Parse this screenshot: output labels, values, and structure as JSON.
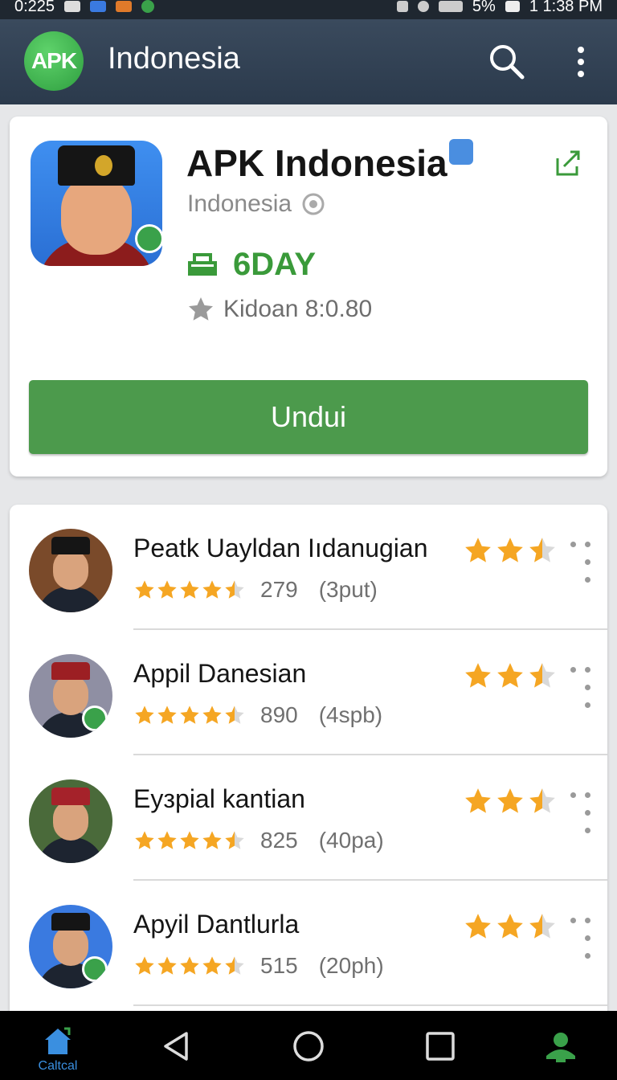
{
  "status_bar": {
    "time_left": "0:225",
    "battery": "5%",
    "time_right": "1 1:38 PM"
  },
  "app_bar": {
    "logo_text": "APK",
    "title": "Indonesia"
  },
  "hero": {
    "app_name": "APK Indonesia",
    "subtitle": "Indonesia",
    "promo": "6DAY",
    "rating_text": "Kidoan 8:0.80",
    "download_label": "Undui"
  },
  "items": [
    {
      "title": "Peatk Uayldan Iıdanugian",
      "count": "279",
      "size": "(3put)",
      "stars": 4.5,
      "mini_stars": 2.5,
      "cap": "#151515",
      "bg": "#7a4a2a",
      "check": false
    },
    {
      "title": "Appil Danesian",
      "count": "890",
      "size": "(4spb)",
      "stars": 4.5,
      "mini_stars": 2.5,
      "cap": "#9c1f23",
      "bg": "#8f8fa3",
      "check": true
    },
    {
      "title": "Eyзpial kantian",
      "count": "825",
      "size": "(40pa)",
      "stars": 4.5,
      "mini_stars": 2.5,
      "cap": "#a5222a",
      "bg": "#4a6a3a",
      "check": false
    },
    {
      "title": "Apyil Dantlurla",
      "count": "515",
      "size": "(20ph)",
      "stars": 4.5,
      "mini_stars": 2.5,
      "cap": "#151515",
      "bg": "#3a7ae0",
      "check": true
    }
  ],
  "nav": {
    "home_label": "Caltcal"
  },
  "colors": {
    "accent_green": "#4c9a4c",
    "star": "#f5a623",
    "appbar": "#2f3e51"
  }
}
